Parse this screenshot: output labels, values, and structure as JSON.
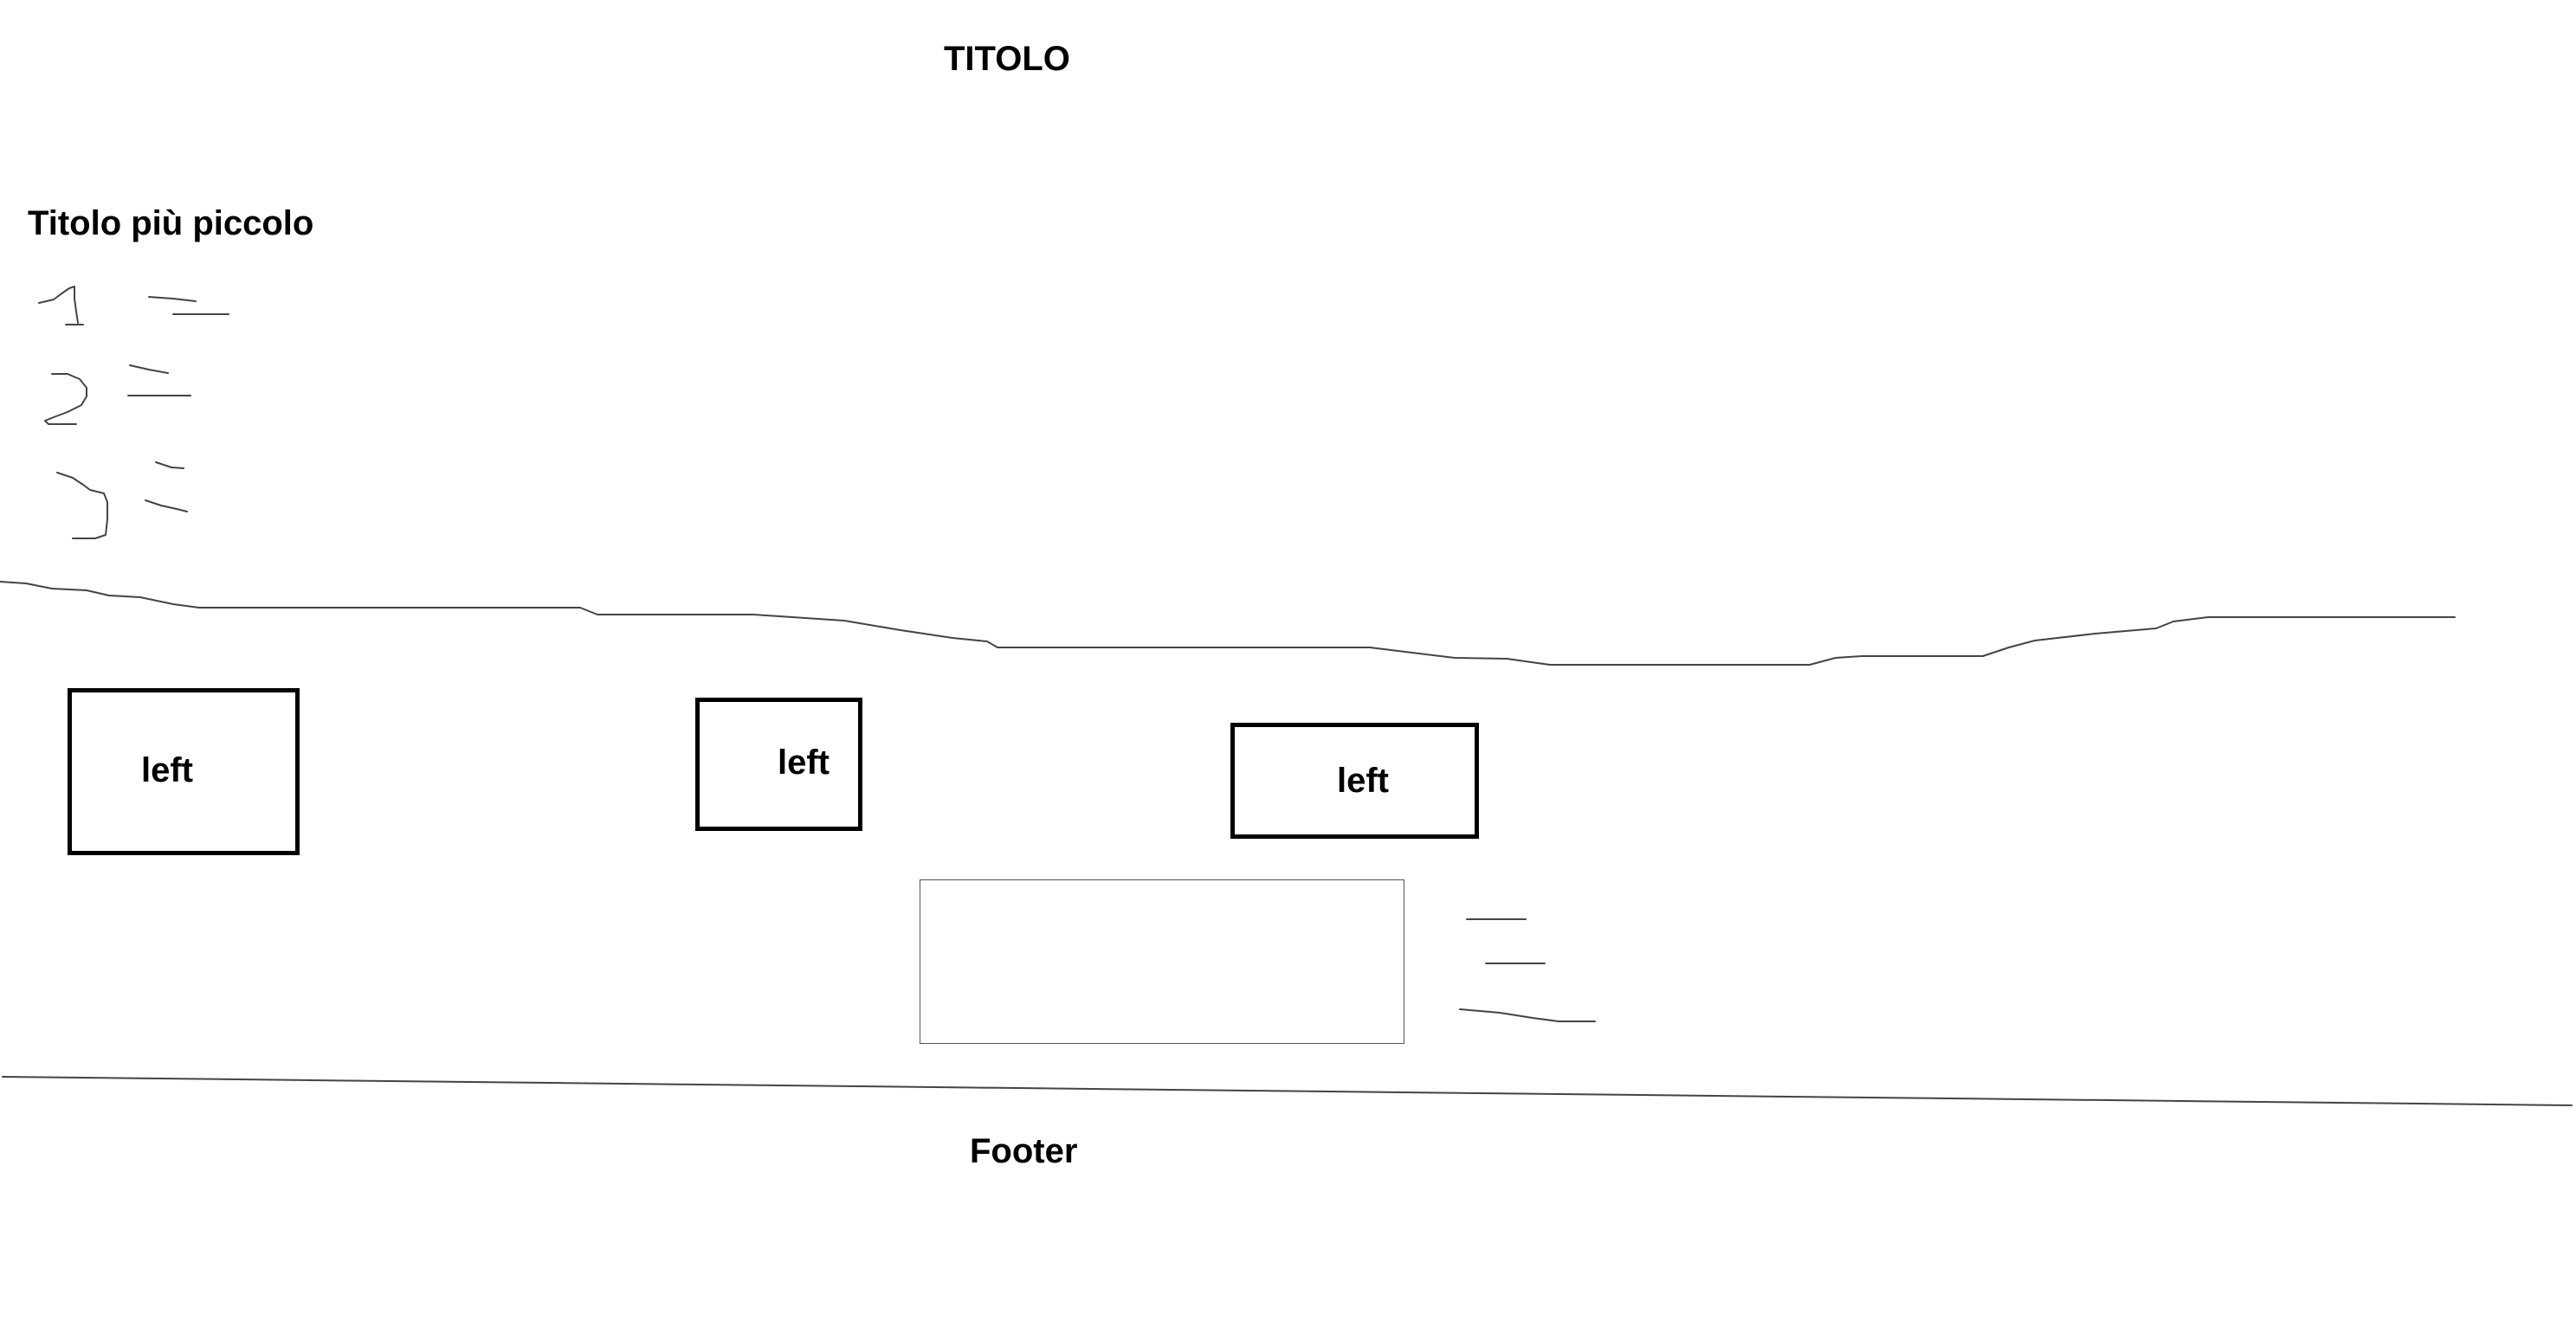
{
  "title": "TITOLO",
  "subtitle": "Titolo più piccolo",
  "list_numbers": [
    "1",
    "2",
    "3"
  ],
  "boxes": [
    {
      "label": "left"
    },
    {
      "label": "left"
    },
    {
      "label": "left"
    }
  ],
  "footer": "Footer",
  "colors": {
    "background": "#ffffff",
    "ink": "#000000",
    "sketch_line": "#444444"
  }
}
